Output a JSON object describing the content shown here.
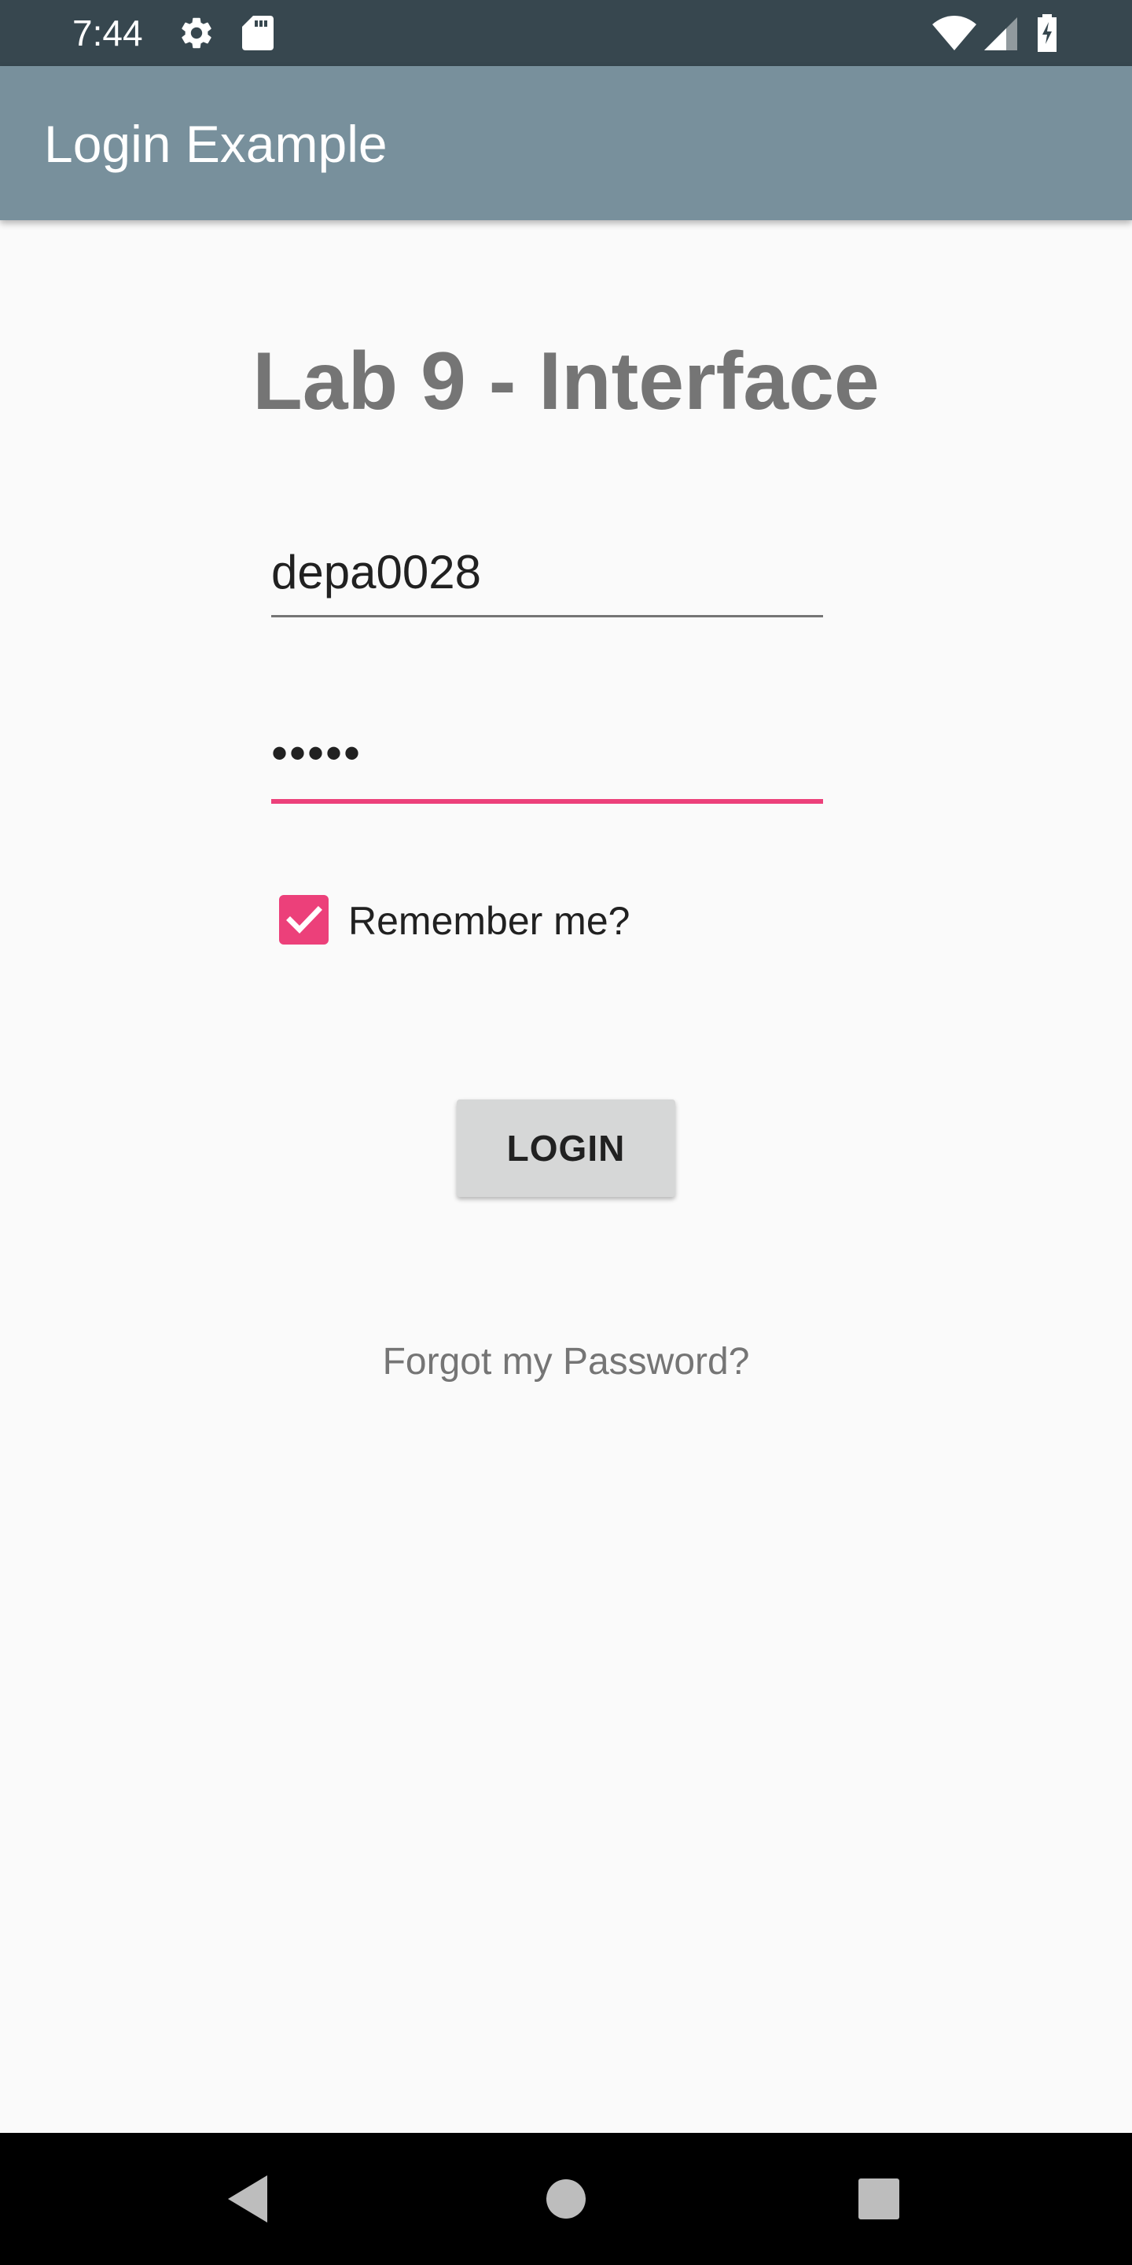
{
  "status_bar": {
    "time": "7:44",
    "icons": [
      "gear-icon",
      "sd-card-icon",
      "wifi-icon",
      "signal-icon",
      "battery-charging-icon"
    ]
  },
  "app_bar": {
    "title": "Login Example"
  },
  "main": {
    "heading": "Lab 9 - Interface",
    "username_value": "depa0028",
    "password_value": "•••••",
    "remember_checked": true,
    "remember_label": "Remember me?",
    "login_label": "LOGIN",
    "forgot_label": "Forgot my Password?"
  },
  "nav_bar": {
    "icons": [
      "back-icon",
      "home-icon",
      "recents-icon"
    ]
  },
  "colors": {
    "status_bar": "#37474f",
    "app_bar": "#78909c",
    "accent": "#ec407a",
    "background": "#fafafa",
    "heading_text": "#757575",
    "button": "#d6d7d7"
  }
}
